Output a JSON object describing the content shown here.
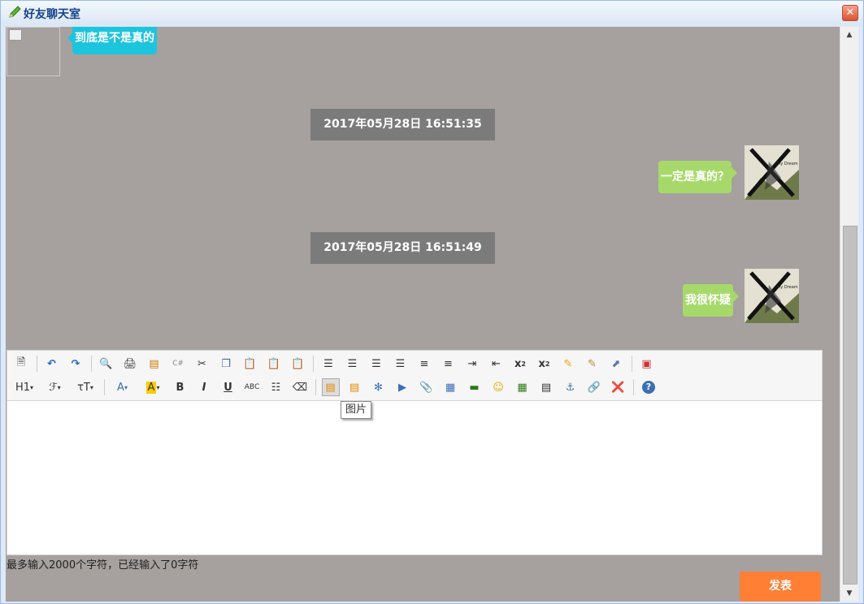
{
  "window": {
    "title": "好友聊天室",
    "close_label": "✕"
  },
  "messages": [
    {
      "side": "left",
      "text": "到底是不是真的"
    },
    {
      "timestamp": "2017年05月28日 16:51:35"
    },
    {
      "side": "right",
      "text": "一定是真的？"
    },
    {
      "timestamp": "2017年05月28日 16:51:49"
    },
    {
      "side": "right",
      "text": "我很怀疑"
    }
  ],
  "editor": {
    "tooltip": "图片",
    "toolbar_row1": [
      "source-icon",
      "undo-icon",
      "redo-icon",
      "preview-icon",
      "print-icon",
      "template-icon",
      "insert-code-icon",
      "cut-icon",
      "copy-icon",
      "paste-icon",
      "paste-text-icon",
      "paste-word-icon",
      "align-left-icon",
      "align-center-icon",
      "align-right-icon",
      "justify-icon",
      "ordered-list-icon",
      "unordered-list-icon",
      "indent-icon",
      "outdent-icon",
      "subscript-icon",
      "superscript-icon",
      "clear-format-icon",
      "select-all-icon",
      "cursor-icon",
      "fullscreen-icon"
    ],
    "toolbar_row2": [
      "heading-icon",
      "font-family-icon",
      "font-size-icon",
      "font-color-icon",
      "background-color-icon",
      "bold-icon",
      "italic-icon",
      "underline-icon",
      "strikethrough-icon",
      "line-height-icon",
      "remove-format-icon",
      "image-icon",
      "multi-image-icon",
      "flash-icon",
      "media-icon",
      "attachment-icon",
      "table-icon",
      "horizontal-rule-icon",
      "emoticon-icon",
      "map-icon",
      "page-break-icon",
      "anchor-icon",
      "link-icon",
      "unlink-icon",
      "help-icon"
    ],
    "h1_label": "H1",
    "bold_label": "B",
    "italic_label": "I",
    "underline_label": "U",
    "strike_label": "ABC"
  },
  "counter": "最多输入2000个字符，已经输入了0字符",
  "send_label": "发表",
  "colors": {
    "accent": "#ff7f35",
    "left_bubble": "#1dc4de",
    "right_bubble": "#a6d96a",
    "chat_bg": "#a6a09f"
  }
}
